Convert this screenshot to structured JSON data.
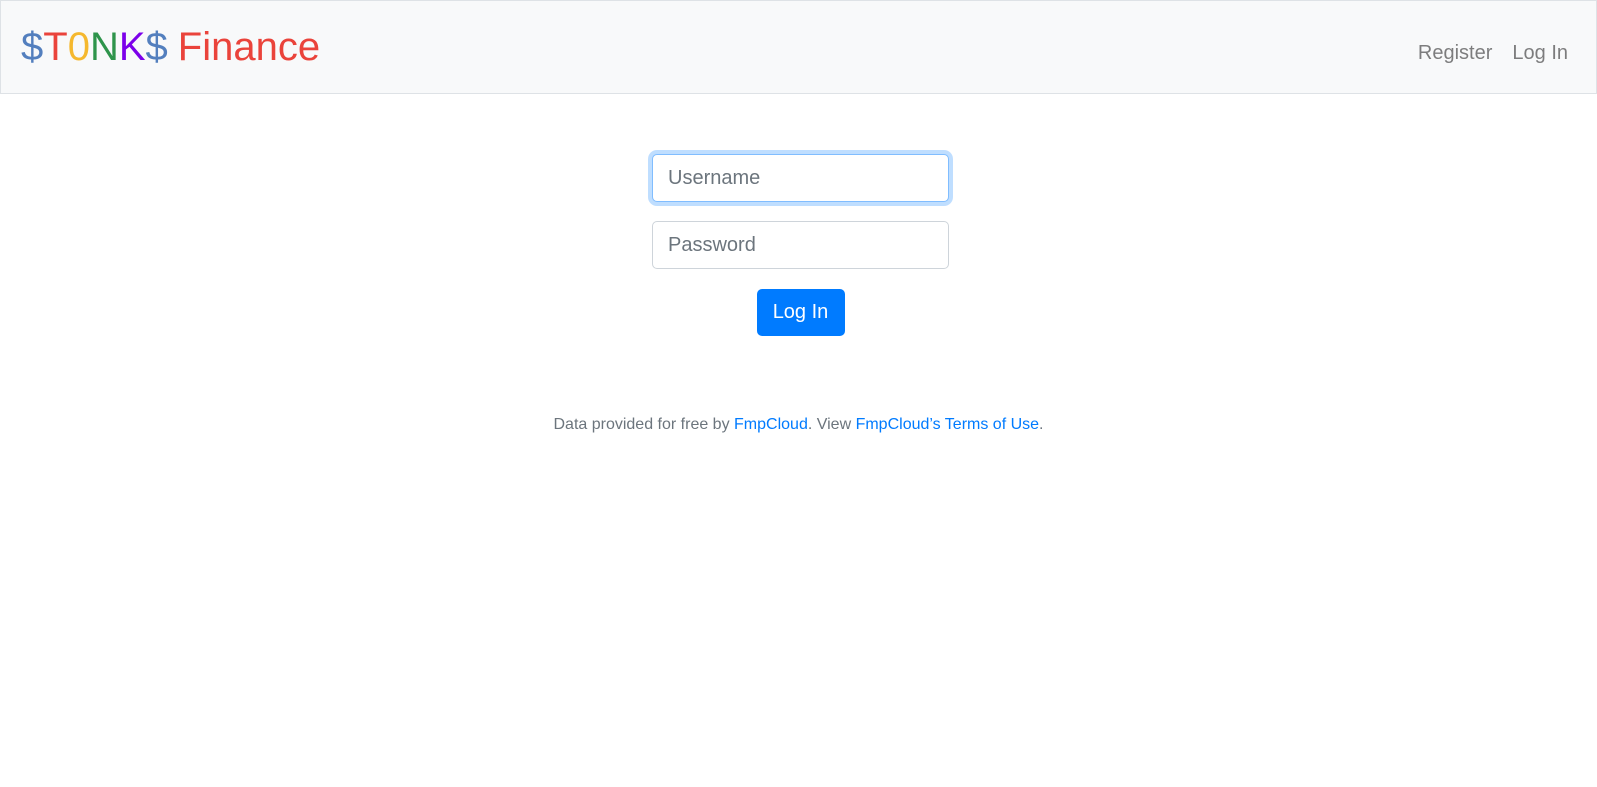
{
  "navbar": {
    "brand": {
      "letters": [
        {
          "text": "$",
          "color": "#537fbe"
        },
        {
          "text": "T",
          "color": "#ea433b"
        },
        {
          "text": "0",
          "color": "#f5b82e"
        },
        {
          "text": "N",
          "color": "#2e944b"
        },
        {
          "text": "K",
          "color": "#7c00ea"
        },
        {
          "text": "$",
          "color": "#537fbe"
        }
      ],
      "word": "Finance",
      "word_color": "#ea433b"
    },
    "register_label": "Register",
    "login_label": "Log In"
  },
  "login_form": {
    "username_placeholder": "Username",
    "password_placeholder": "Password",
    "submit_label": "Log In"
  },
  "footer": {
    "text_before": "Data provided for free by ",
    "provider_link": "FmpCloud",
    "text_middle": ". View ",
    "terms_link": "FmpCloud’s Terms of Use",
    "text_after": "."
  },
  "colors": {
    "navbar_bg": "#f8f9fa",
    "primary": "#007bff",
    "muted": "#6c757d"
  }
}
